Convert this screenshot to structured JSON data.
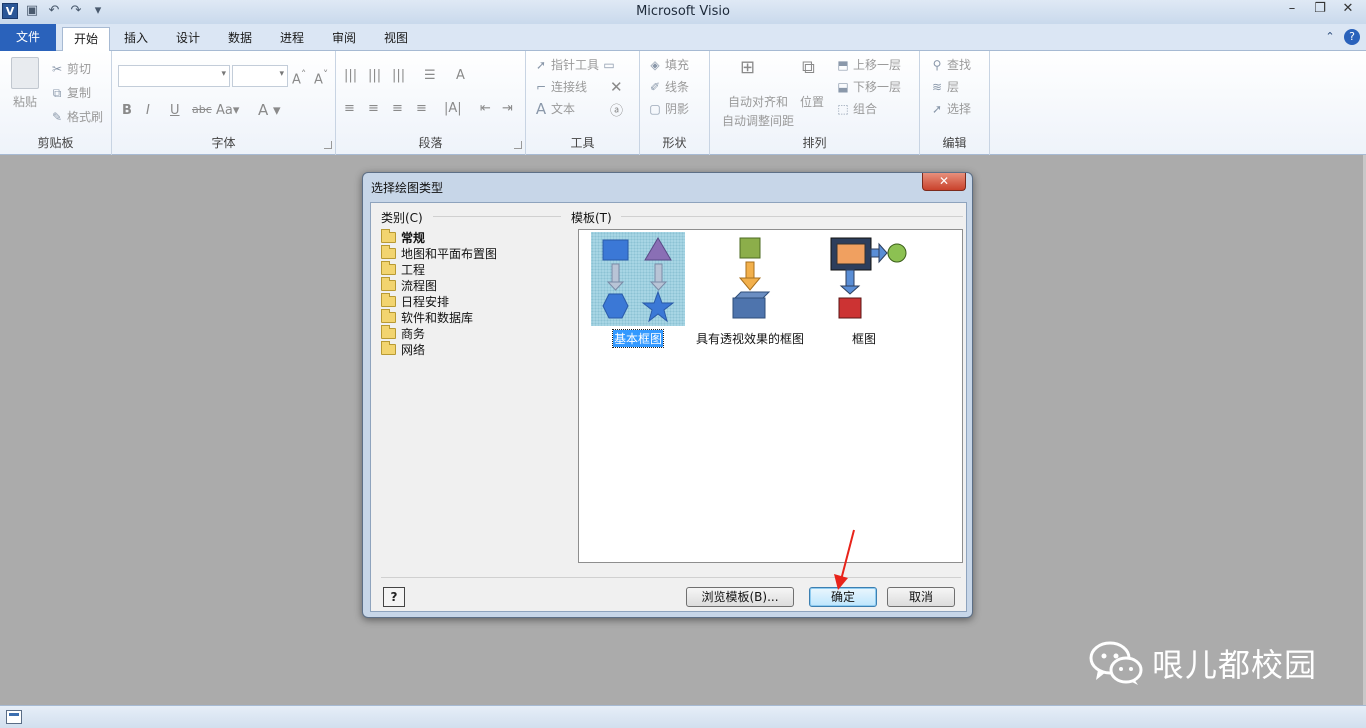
{
  "window": {
    "title": "Microsoft Visio",
    "app_icon": "V"
  },
  "tabs": [
    {
      "label": "文件"
    },
    {
      "label": "开始"
    },
    {
      "label": "插入"
    },
    {
      "label": "设计"
    },
    {
      "label": "数据"
    },
    {
      "label": "进程"
    },
    {
      "label": "审阅"
    },
    {
      "label": "视图"
    }
  ],
  "ribbon": {
    "clipboard": {
      "name": "剪贴板",
      "paste": "粘贴",
      "cut": "剪切",
      "copy": "复制",
      "format_painter": "格式刷"
    },
    "font": {
      "name": "字体"
    },
    "paragraph": {
      "name": "段落"
    },
    "tools": {
      "name": "工具",
      "pointer": "指针工具",
      "connector": "连接线",
      "text": "文本"
    },
    "shape": {
      "name": "形状",
      "fill": "填充",
      "line": "线条",
      "shadow": "阴影"
    },
    "arrange": {
      "name": "排列",
      "auto_align": "自动对齐和",
      "auto_space": "自动调整间距",
      "position": "位置",
      "bring_forward": "上移一层",
      "send_backward": "下移一层",
      "group": "组合"
    },
    "edit": {
      "name": "编辑",
      "find": "查找",
      "layers": "层",
      "select": "选择"
    }
  },
  "dialog": {
    "title": "选择绘图类型",
    "category_label": "类别(C)",
    "template_label": "模板(T)",
    "categories": [
      "常规",
      "地图和平面布置图",
      "工程",
      "流程图",
      "日程安排",
      "软件和数据库",
      "商务",
      "网络"
    ],
    "selected_category": "常规",
    "templates": [
      {
        "name": "基本框图",
        "selected": true
      },
      {
        "name": "具有透视效果的框图",
        "selected": false
      },
      {
        "name": "框图",
        "selected": false
      }
    ],
    "browse_button": "浏览模板(B)...",
    "ok_button": "确定",
    "cancel_button": "取消",
    "help_button": "?",
    "close_button": "✕"
  },
  "watermark": {
    "text": "哏儿都校园"
  },
  "colors": {
    "file_tab": "#2a62bb",
    "selection": "#3399ff",
    "close_button": "#c9422c",
    "annotation_arrow": "#e8231a"
  }
}
